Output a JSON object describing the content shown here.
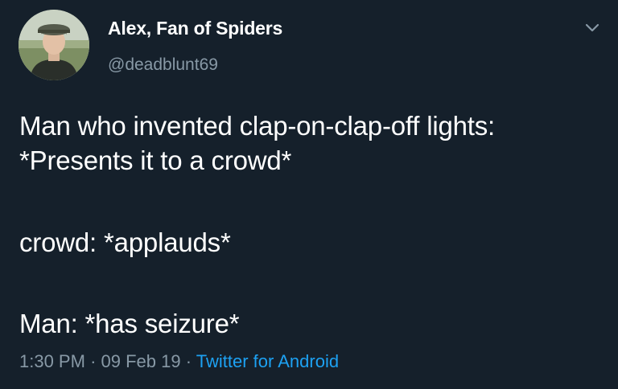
{
  "user": {
    "display_name": "Alex, Fan of Spiders",
    "handle": "@deadblunt69",
    "avatar_icon": "profile-photo"
  },
  "tweet": {
    "lines": [
      "Man who invented clap-on-clap-off lights:",
      "*Presents it to a crowd*",
      "crowd: *applauds*",
      "Man: *has seizure*"
    ],
    "time": "1:30 PM",
    "date": "09 Feb 19",
    "separator": "·",
    "source": "Twitter for Android"
  },
  "colors": {
    "background": "#15202b",
    "text": "#ffffff",
    "secondary": "#8899a6",
    "link": "#1da1f2"
  },
  "icons": {
    "menu": "chevron-down-icon"
  }
}
